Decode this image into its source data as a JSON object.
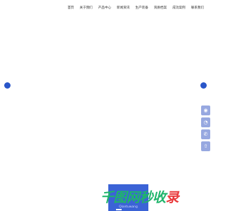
{
  "nav": {
    "items": [
      "首页",
      "关于我们",
      "产品中心",
      "新闻资讯",
      "生产装备",
      "资质档案",
      "成功案例",
      "联系我们"
    ]
  },
  "side_tools": [
    {
      "icon": "headset-icon",
      "glyph": "◉"
    },
    {
      "icon": "chat-icon",
      "glyph": "◔"
    },
    {
      "icon": "phone-icon",
      "glyph": "✆"
    },
    {
      "icon": "back-to-top-icon",
      "glyph": "⇧"
    }
  ],
  "promo": {
    "headline_main": "千图网秒收",
    "headline_accent": "录",
    "subline": "Qiantuwang"
  },
  "colors": {
    "accent_blue": "#2a56c9",
    "tool_blue": "#97a8e0",
    "promo_green": "#1fb56b",
    "promo_red": "#e9393b"
  }
}
